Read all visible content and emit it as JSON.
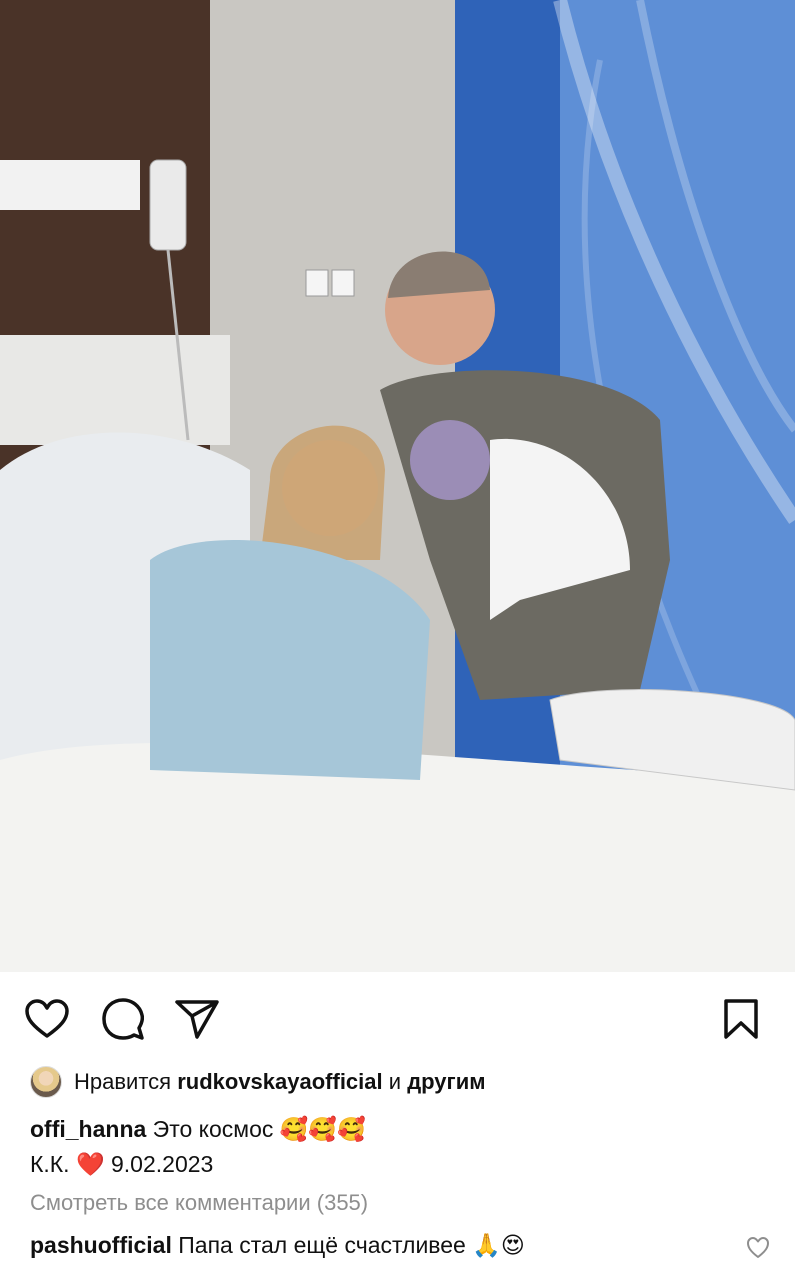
{
  "post": {
    "photo_alt": "Hospital room photo",
    "liked_by_label": "Нравится",
    "liked_by_user": "rudkovskayaofficial",
    "liked_by_and": "и",
    "liked_by_others": "другим",
    "caption_user": "offi_hanna",
    "caption_text": "Это космос",
    "caption_emojis": "🥰🥰🥰",
    "caption_line2_initials": "К.К.",
    "caption_line2_heart": "❤️",
    "caption_line2_date": "9.02.2023",
    "view_comments": "Смотреть все комментарии (355)",
    "comment_user": "pashuofficial",
    "comment_text": "Папа стал ещё счастливее",
    "comment_emojis": "🙏😍"
  },
  "icons": {
    "like": "heart-icon",
    "comment": "comment-icon",
    "share": "send-icon",
    "save": "bookmark-icon",
    "comment_like": "heart-small-icon"
  },
  "colors": {
    "text": "#111111",
    "muted": "#8e8e8e",
    "heart_red": "#e0245e"
  }
}
